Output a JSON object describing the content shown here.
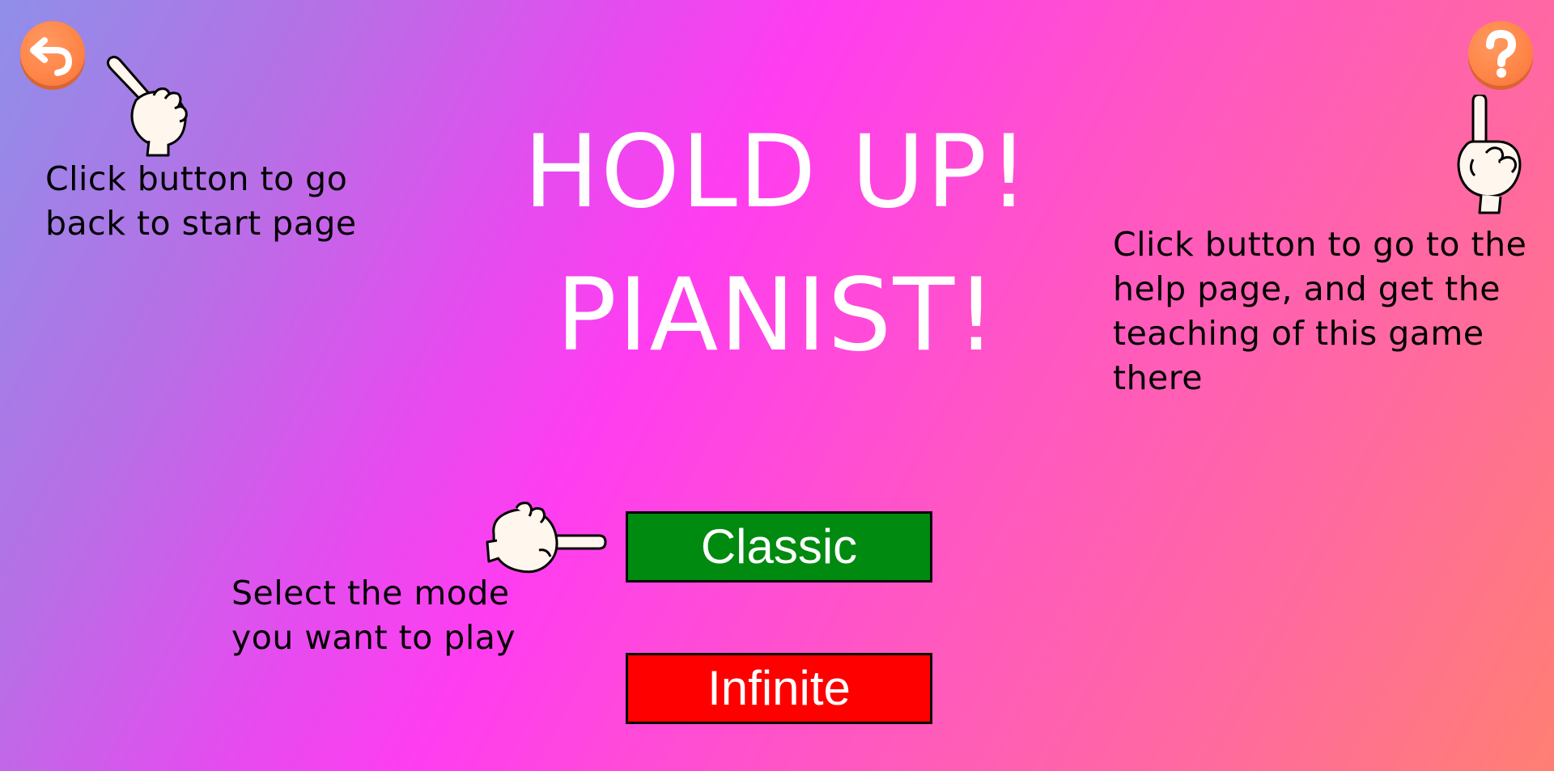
{
  "title": {
    "line1": "HOLD UP!",
    "line2": "PIANIST!"
  },
  "buttons": {
    "back_icon": "back-arrow-icon",
    "help_icon": "question-mark-icon",
    "classic_label": "Classic",
    "infinite_label": "Infinite"
  },
  "hints": {
    "back": "Click button to go\nback to start page",
    "help": "Click button to go to the\nhelp page, and get the\nteaching of this game\nthere",
    "mode": "Select the mode\nyou want to play"
  },
  "colors": {
    "round_button": "#ff8447",
    "classic_button": "#008a0f",
    "infinite_button": "#ff0000",
    "title_text": "#ffffff"
  }
}
